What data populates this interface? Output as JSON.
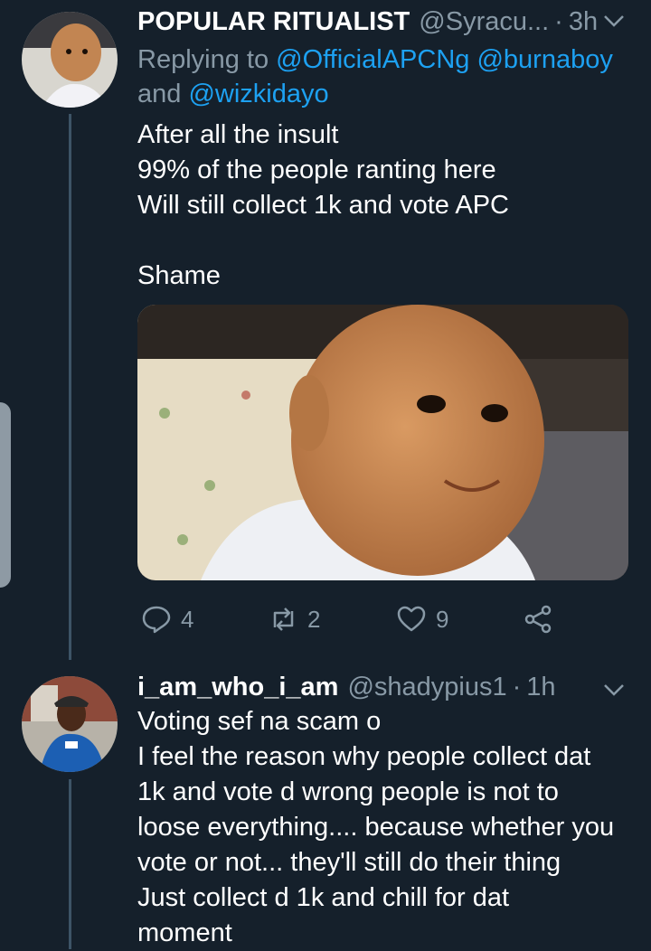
{
  "tweet1": {
    "name": "POPULAR RITUALIST",
    "handle": "@Syracu...",
    "separator": "·",
    "time": "3h",
    "replying_prefix": "Replying to",
    "mentions": [
      "@OfficialAPCNg",
      "@burnaboy"
    ],
    "mentions_joiner": "and",
    "mention_last": "@wizkidayo",
    "lines": [
      "After all the insult",
      "99% of the people ranting here",
      "Will still collect 1k and vote APC",
      "",
      "Shame"
    ],
    "actions": {
      "replies": "4",
      "retweets": "2",
      "likes": "9"
    }
  },
  "tweet2": {
    "name": "i_am_who_i_am",
    "handle": "@shadypius1",
    "separator": "·",
    "time": "1h",
    "lines": [
      "Voting sef na scam o",
      "I feel the reason why people collect dat",
      "1k and vote d wrong people is not to",
      "loose everything.... because whether you",
      "vote or not... they'll still do their thing",
      "Just collect d 1k and chill for dat",
      "moment"
    ]
  },
  "colors": {
    "background": "#15202b",
    "text": "#ffffff",
    "secondary": "#8899a6",
    "link": "#1da1f2",
    "thread_line": "#3d5466"
  },
  "icons": [
    "chevron-down-icon",
    "reply-icon",
    "retweet-icon",
    "like-icon",
    "share-icon"
  ]
}
